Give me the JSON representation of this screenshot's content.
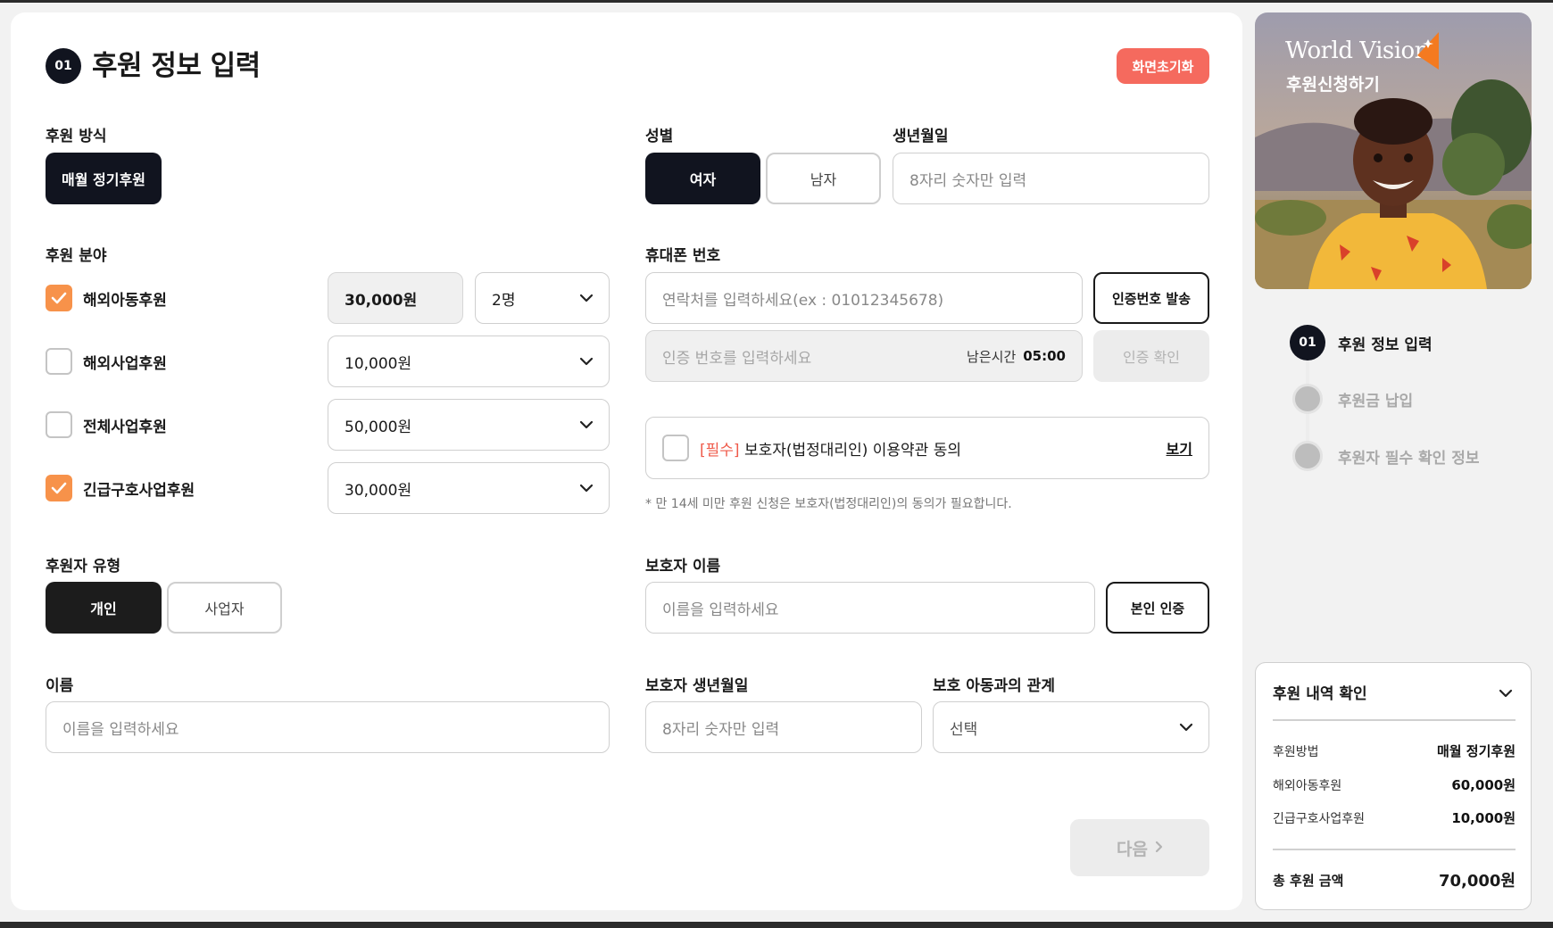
{
  "header": {
    "step_number": "01",
    "title": "후원 정보 입력",
    "reset_label": "화면초기화"
  },
  "donation_method": {
    "label": "후원 방식",
    "selected": "매월 정기후원"
  },
  "donation_field": {
    "label": "후원 분야",
    "items": [
      {
        "name": "해외아동후원",
        "checked": true,
        "amount": "30,000원",
        "count": "2명"
      },
      {
        "name": "해외사업후원",
        "checked": false,
        "amount": "10,000원"
      },
      {
        "name": "전체사업후원",
        "checked": false,
        "amount": "50,000원"
      },
      {
        "name": "긴급구호사업후원",
        "checked": true,
        "amount": "30,000원"
      }
    ]
  },
  "donor_type": {
    "label": "후원자 유형",
    "options": [
      "개인",
      "사업자"
    ],
    "selected": "개인"
  },
  "name": {
    "label": "이름",
    "placeholder": "이름을 입력하세요"
  },
  "gender": {
    "label": "성별",
    "options": [
      "여자",
      "남자"
    ],
    "selected": "여자"
  },
  "birthdate": {
    "label": "생년월일",
    "placeholder": "8자리 숫자만 입력"
  },
  "phone": {
    "label": "휴대폰 번호",
    "placeholder": "연락처를 입력하세요(ex : 01012345678)",
    "send_code_label": "인증번호 발송",
    "code_placeholder": "인증 번호를 입력하세요",
    "timer_label": "남은시간",
    "timer_value": "05:00",
    "verify_label": "인증 확인"
  },
  "terms": {
    "required_tag": "[필수]",
    "text": "보호자(법정대리인) 이용약관 동의",
    "view_label": "보기",
    "note": "* 만 14세 미만 후원 신청은 보호자(법정대리인)의 동의가 필요합니다."
  },
  "guardian": {
    "name_label": "보호자 이름",
    "name_placeholder": "이름을 입력하세요",
    "verify_label": "본인 인증",
    "birth_label": "보호자 생년월일",
    "birth_placeholder": "8자리 숫자만 입력",
    "relation_label": "보호 아동과의 관계",
    "relation_value": "선택"
  },
  "next_label": "다음",
  "hero": {
    "brand": "World Vision",
    "subtitle": "후원신청하기"
  },
  "steps": [
    {
      "number": "01",
      "label": "후원 정보 입력",
      "active": true
    },
    {
      "number": "",
      "label": "후원금 납입",
      "active": false
    },
    {
      "number": "",
      "label": "후원자 필수 확인 정보",
      "active": false
    }
  ],
  "summary": {
    "title": "후원 내역 확인",
    "rows": [
      {
        "key": "후원방법",
        "value": "매월 정기후원"
      },
      {
        "key": "해외아동후원",
        "value": "60,000원"
      },
      {
        "key": "긴급구호사업후원",
        "value": "10,000원"
      }
    ],
    "total_key": "총 후원 금액",
    "total_value": "70,000원"
  },
  "colors": {
    "accent_orange": "#f7924a",
    "reset_red": "#f56a5e",
    "dark": "#11141f",
    "required_red": "#ef5a4a"
  }
}
